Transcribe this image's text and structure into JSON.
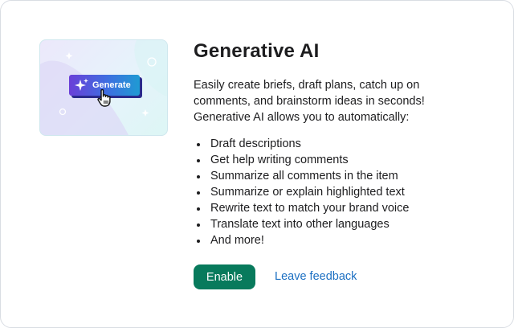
{
  "illustration": {
    "button_label": "Generate",
    "sparkle_icon": "sparkle-icon",
    "cursor_icon": "pointer-hand-icon"
  },
  "content": {
    "title": "Generative AI",
    "description": "Easily create briefs, draft plans, catch up on comments, and brainstorm ideas in seconds! Generative AI allows you to automatically:",
    "features": [
      "Draft descriptions",
      "Get help writing comments",
      "Summarize all comments in the item",
      "Summarize or explain highlighted text",
      "Rewrite text to match your brand voice",
      "Translate text into other languages",
      "And more!"
    ]
  },
  "actions": {
    "enable_label": "Enable",
    "feedback_label": "Leave feedback"
  },
  "colors": {
    "primary_button": "#087a5c",
    "link": "#1b6fc2",
    "generate_gradient_start": "#6a3fd8",
    "generate_gradient_end": "#1f9bd3"
  }
}
